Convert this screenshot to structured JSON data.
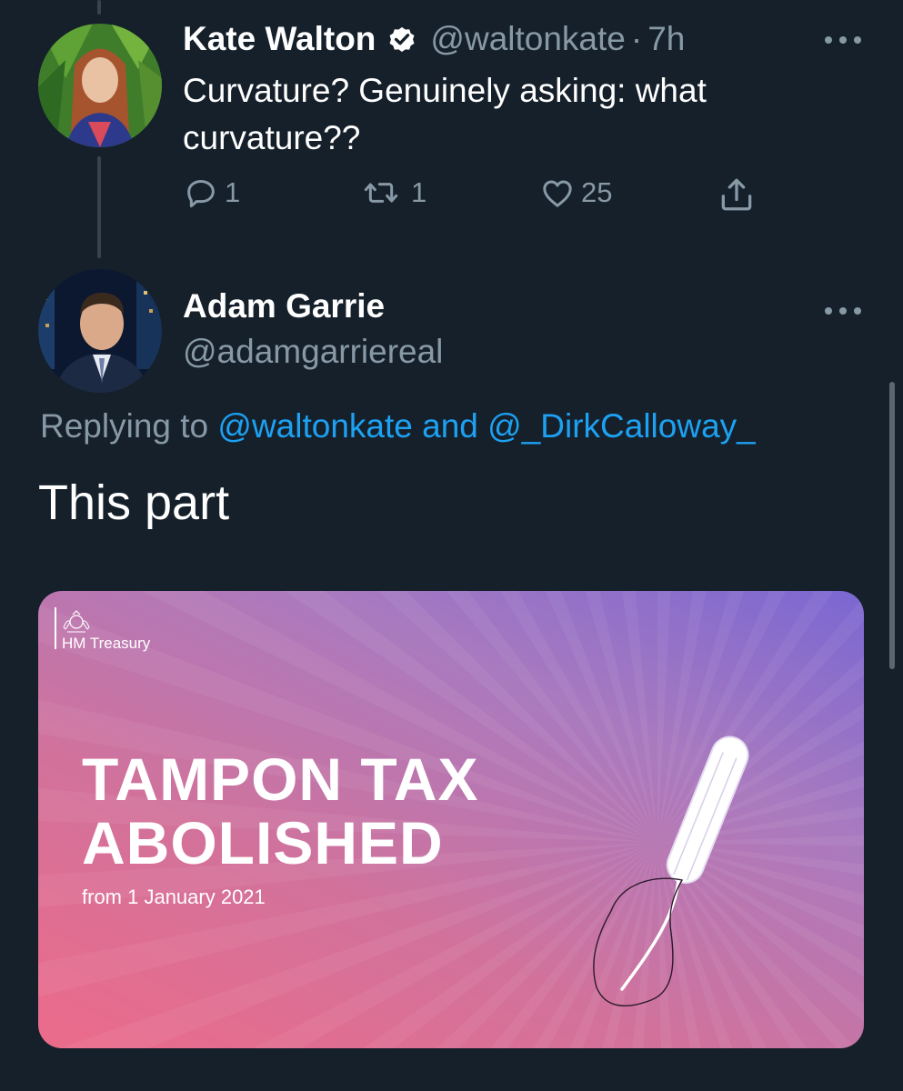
{
  "tweet1": {
    "display_name": "Kate Walton",
    "verified": true,
    "handle": "@waltonkate",
    "separator": "·",
    "time": "7h",
    "text": "Curvature? Genuinely asking: what curvature??",
    "actions": {
      "reply_count": "1",
      "retweet_count": "1",
      "like_count": "25"
    }
  },
  "tweet2": {
    "display_name": "Adam Garrie",
    "handle": "@adamgarriereal",
    "replying_prefix": "Replying to",
    "replying_user1": "@waltonkate",
    "replying_and": "and",
    "replying_user2": "@_DirkCalloway_",
    "text": "This part",
    "media": {
      "org_label": "HM Treasury",
      "headline_line1": "TAMPON TAX",
      "headline_line2": "ABOLISHED",
      "subline": "from 1 January 2021"
    }
  },
  "icons": [
    "verified-badge-icon",
    "more-icon",
    "reply-icon",
    "retweet-icon",
    "like-icon",
    "share-icon",
    "royal-crest-icon",
    "tampon-illustration"
  ],
  "colors": {
    "background": "#15202b",
    "secondary_text": "#8899a6",
    "link": "#1da1f2",
    "gradient_start": "#ec6b8a",
    "gradient_end": "#7a67d2"
  }
}
